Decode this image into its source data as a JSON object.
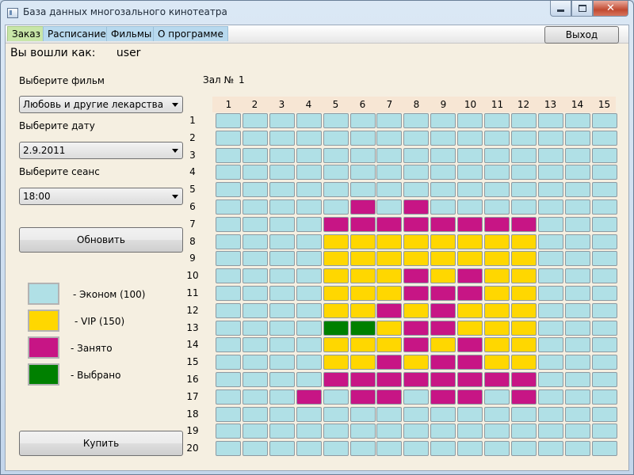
{
  "window": {
    "title": "База данных многозального кинотеатра",
    "icon": "app-window-icon",
    "controls": {
      "minimize": "minimize-icon",
      "maximize": "maximize-icon",
      "close": "✕"
    }
  },
  "tabs": [
    {
      "label": "Заказ",
      "active": true
    },
    {
      "label": "Расписание",
      "active": false
    },
    {
      "label": "Фильмы",
      "active": false
    },
    {
      "label": "О программе",
      "active": false
    }
  ],
  "exit_button": "Выход",
  "login": {
    "label": "Вы вошли как:",
    "user": "user"
  },
  "film": {
    "label": "Выберите фильм",
    "value": "Любовь и другие лекарства"
  },
  "date": {
    "label": "Выберите дату",
    "value": "2.9.2011"
  },
  "session": {
    "label": "Выберите сеанс",
    "value": "18:00"
  },
  "refresh_button": "Обновить",
  "buy_button": "Купить",
  "legend": [
    {
      "label": "- Эконом (100)",
      "color": "#b0e0e6",
      "type": "economy"
    },
    {
      "label": "- VIP (150)",
      "color": "#ffd700",
      "type": "vip"
    },
    {
      "label": "- Занято",
      "color": "#c71585",
      "type": "taken"
    },
    {
      "label": "- Выбрано",
      "color": "#008000",
      "type": "selected"
    }
  ],
  "hall": {
    "label": "Зал №",
    "number": "1",
    "columns": [
      "1",
      "2",
      "3",
      "4",
      "5",
      "6",
      "7",
      "8",
      "9",
      "10",
      "11",
      "12",
      "13",
      "14",
      "15"
    ],
    "rows": [
      "1",
      "2",
      "3",
      "4",
      "5",
      "6",
      "7",
      "8",
      "9",
      "10",
      "11",
      "12",
      "13",
      "14",
      "15",
      "16",
      "17",
      "18",
      "19",
      "20"
    ],
    "seat_codes": {
      "E": "economy",
      "V": "vip",
      "T": "taken",
      "S": "selected"
    },
    "seat_map": [
      "EEEEEEEEEEEEEEE",
      "EEEEEEEEEEEEEEE",
      "EEEEEEEEEEEEEEE",
      "EEEEEEEEEEEEEEE",
      "EEEEEEEEEEEEEEE",
      "EEEEETETEEEEEEE",
      "EEEETTTTTTTTEEE",
      "EEEEVVVVVVVVEEE",
      "EEEEVVVVVVVVEEE",
      "EEEEVVVTVTVVEEE",
      "EEEEVVVTTTVVEEE",
      "EEEEVVTVTVVVEEE",
      "EEEESSVTTVVVEEE",
      "EEEEVVVTVTVVEEE",
      "EEEEVVTVTTVVEEE",
      "EEEETTTTTTTTEEE",
      "EEETETTETTETEEE",
      "EEEEEEEEEEEEEEE",
      "EEEEEEEEEEEEEEE",
      "EEEEEEEEEEEEEEE"
    ]
  }
}
